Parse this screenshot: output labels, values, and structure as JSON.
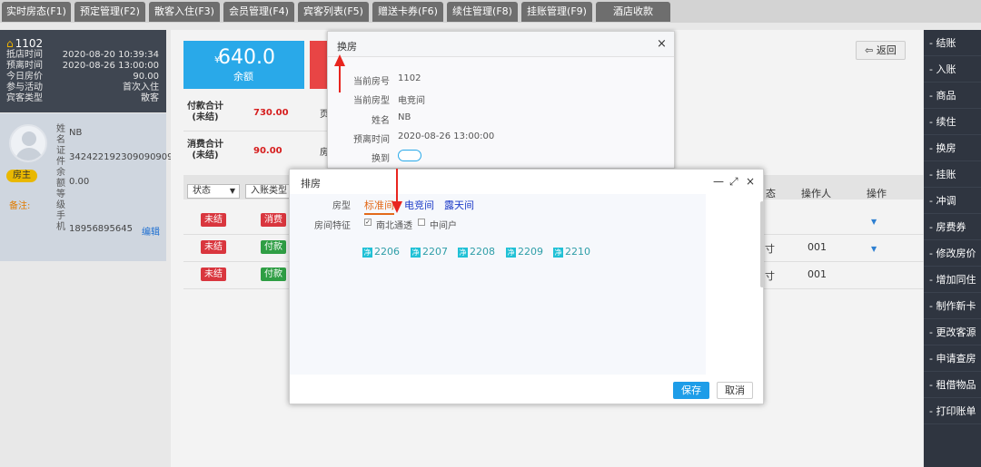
{
  "tabs": [
    "实时房态(F1)",
    "预定管理(F2)",
    "散客入住(F3)",
    "会员管理(F4)",
    "宾客列表(F5)",
    "赠送卡券(F6)",
    "续住管理(F8)",
    "挂账管理(F9)",
    "酒店收款"
  ],
  "room": {
    "number": "1102",
    "rows": [
      {
        "k": "抵店时间",
        "v": "2020-08-20 10:39:34"
      },
      {
        "k": "预离时间",
        "v": "2020-08-26 13:00:00"
      },
      {
        "k": "今日房价",
        "v": "90.00"
      },
      {
        "k": "参与活动",
        "v": "首次入住"
      },
      {
        "k": "宾客类型",
        "v": "散客"
      }
    ]
  },
  "guest": {
    "vertical_labels": "姓名证件余额等级手机",
    "name": "NB",
    "id_number": "342422192309090909",
    "balance": "0.00",
    "phone": "18956895645",
    "edit": "编辑",
    "owner_badge": "房主",
    "remark_label": "备注:"
  },
  "summary": {
    "balance_value": "640.0",
    "balance_currency": "¥",
    "balance_label": "余额",
    "pay_label_1": "付款合计",
    "pay_label_2": "(未结)",
    "pay_value": "730.00",
    "consume_label_1": "消费合计",
    "consume_label_2": "(未结)",
    "consume_value": "90.00",
    "cut1": "页",
    "cut2": "房"
  },
  "back_button": "返回",
  "filters": {
    "status": "状态",
    "entry_type": "入账类型"
  },
  "table": {
    "header_cut": "态",
    "operator_header": "操作人",
    "action_header": "操作",
    "rows": [
      {
        "status": "未结",
        "type": "消费",
        "cut": "",
        "operator": ""
      },
      {
        "status": "未结",
        "type": "付款",
        "cut": "寸",
        "operator": "001"
      },
      {
        "status": "未结",
        "type": "付款",
        "cut": "寸",
        "operator": "001"
      }
    ]
  },
  "right_menu": [
    "- 结账",
    "- 入账",
    "- 商品",
    "- 续住",
    "- 换房",
    "- 挂账",
    "- 冲调",
    "- 房费券",
    "- 修改房价",
    "- 增加同住",
    "- 制作新卡",
    "- 更改客源",
    "- 申请查房",
    "- 租借物品",
    "- 打印账单"
  ],
  "dialog_change_room": {
    "title": "换房",
    "close": "×",
    "fields": [
      {
        "label": "当前房号",
        "value": "1102"
      },
      {
        "label": "当前房型",
        "value": "电竞间"
      },
      {
        "label": "姓名",
        "value": "NB"
      },
      {
        "label": "预离时间",
        "value": "2020-08-26 13:00:00"
      },
      {
        "label": "换到",
        "value": ""
      }
    ]
  },
  "dialog_assign_room": {
    "title": "排房",
    "controls": [
      "—",
      "⤢",
      "×"
    ],
    "room_type_label": "房型",
    "room_types": [
      "标准间",
      "电竞间",
      "露天间"
    ],
    "active_room_type": "标准间",
    "feature_label": "房间特征",
    "features": [
      {
        "label": "南北通透",
        "checked": true
      },
      {
        "label": "中间户",
        "checked": false
      }
    ],
    "room_badge": "净",
    "rooms": [
      "2206",
      "2207",
      "2208",
      "2209",
      "2210"
    ],
    "save": "保存",
    "cancel": "取消"
  },
  "colors": {
    "accent": "#29a9e9",
    "danger": "#d9363e",
    "success": "#2f9e44",
    "arrow": "#e8251f",
    "active_tab": "#e36a1a"
  }
}
